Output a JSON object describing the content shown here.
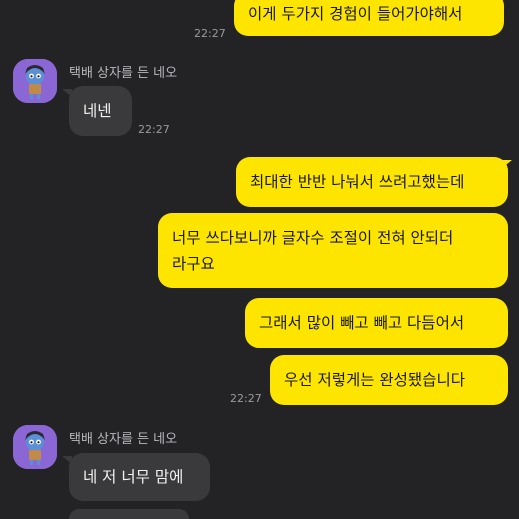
{
  "chat": {
    "partner_name": "택배 상자를 든 네오",
    "colors": {
      "background": "#232326",
      "my_bubble": "#fee500",
      "other_bubble": "#3a3a3d"
    },
    "messages": [
      {
        "sender": "me",
        "text": "이게 두가지 경험이 들어가야해서",
        "time": "22:27"
      },
      {
        "sender": "other",
        "text": "네넨",
        "time": "22:27"
      },
      {
        "sender": "me",
        "text": "최대한 반반 나눠서 쓰려고했는데"
      },
      {
        "sender": "me",
        "lines": [
          "너무 쓰다보니까 글자수 조절이 전혀 안되더",
          "라구요"
        ]
      },
      {
        "sender": "me",
        "text": "그래서 많이 빼고 빼고 다듬어서"
      },
      {
        "sender": "me",
        "text": "우선 저렇게는 완성됐습니다",
        "time": "22:27"
      },
      {
        "sender": "other",
        "text": "네 저 너무 맘에"
      }
    ]
  }
}
